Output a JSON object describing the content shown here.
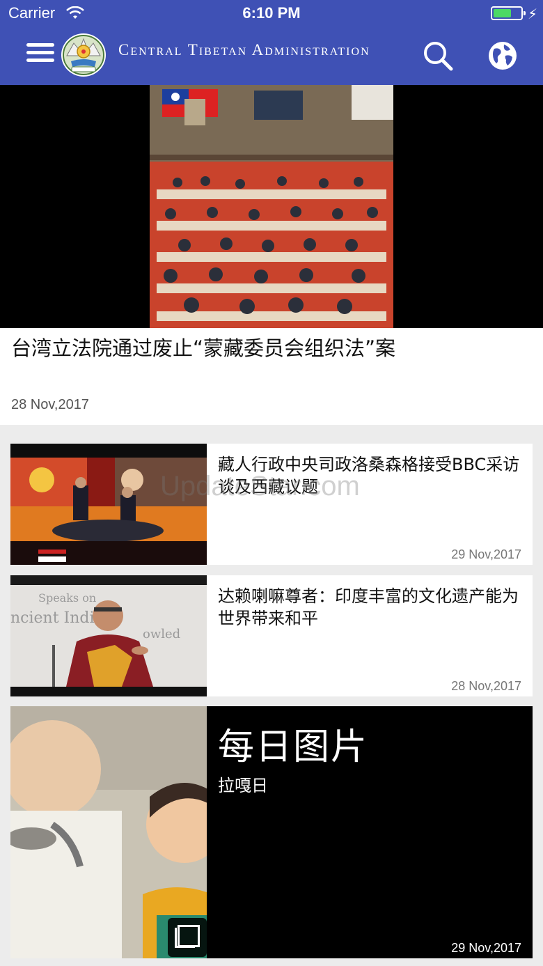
{
  "status_bar": {
    "carrier": "Carrier",
    "time": "6:10 PM"
  },
  "header": {
    "title": "Central Tibetan Administration",
    "menu_icon": "hamburger-icon",
    "search_icon": "search-icon",
    "language_icon": "globe-icon",
    "background_color": "#3f51b5"
  },
  "featured": {
    "title": "台湾立法院通过废止“蒙藏委员会组织法”案",
    "date": "28 Nov,2017"
  },
  "articles": [
    {
      "title": "藏人行政中央司政洛桑森格接受BBC采访谈及西藏议题",
      "date": "29 Nov,2017"
    },
    {
      "title": "达赖喇嘛尊者：印度丰富的文化遗产能为世界带来和平",
      "date": "28 Nov,2017"
    }
  ],
  "photo_of_day": {
    "heading": "每日图片",
    "caption": "拉嘎日",
    "date": "29 Nov,2017"
  },
  "watermark": "UpdateStar.com"
}
